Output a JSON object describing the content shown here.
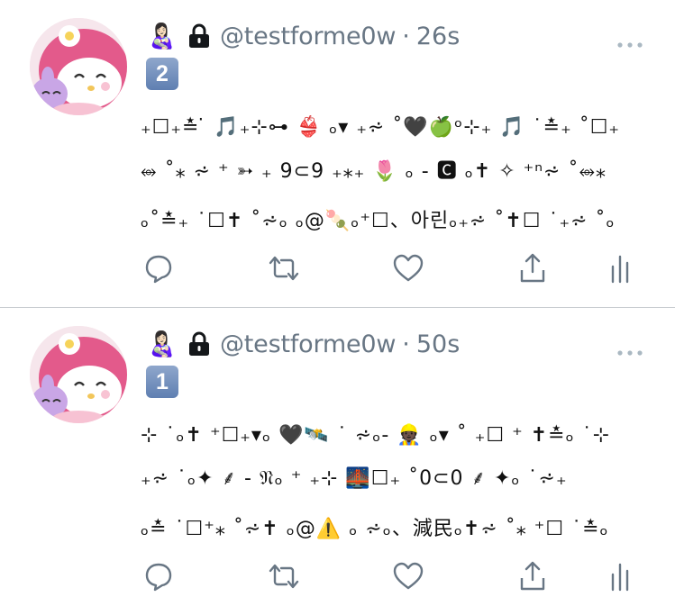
{
  "tweets": [
    {
      "name_emoji": "👩🏻‍🍼",
      "handle": "@testforme0w",
      "separator": "·",
      "time": "26s",
      "number_badge": "2",
      "lines": [
        "₊☐₊≛ ̇ 🎵₊⊹⊶ 👙 ₒ▾ ₊⩫ ˚🖤🍏ᵒ⊹₊ 🎵 ˙≛₊ ˚☐₊",
        "⥈ ˚⁎ ⩫ ⁺ ➳ ₊ 9⊂9 ₊⁎₊ 🌷 ₒ - 🅲 ₒ✝ ✧ ⁺ⁿ⩫ ˚⥈⁎",
        "ₒ˚≛₊ ˙☐✝ ˚⩫ₒ ₒ@🍡ₒ⁺☐、아린ₒ₊⩫ ˚✝☐ ˙₊⩫ ˚ₒ"
      ]
    },
    {
      "name_emoji": "👩🏻‍🍼",
      "handle": "@testforme0w",
      "separator": "·",
      "time": "50s",
      "number_badge": "1",
      "lines": [
        "⊹ ˙ₒ✝ ⁺☐₊▾ₒ 🖤🛰️ ˙ ⩫ₒ- 👷🏿 ₒ▾ ˚ ₊☐ ⁺ ✝≛ₒ ˙⊹",
        "₊⩫ ˙ₒ✦ ⸙ - 𝔑ₒ ⁺ ₊⊹ 🌉☐₊ ˚0⊂0 ⸙ ✦ₒ ˙⩫₊",
        "ₒ≛ ˙☐⁺⁎ ˚⩫✝ ₒ@⚠️ ₒ ⩫ₒ、減民ₒ✝⩫ ˚⁎ ⁺☐ ˙≛ₒ"
      ]
    }
  ],
  "colors": {
    "muted": "#687684",
    "divider": "#c9cdd1",
    "avatar_pink": "#e35a8b"
  },
  "icons": [
    "lock-icon",
    "more-icon",
    "reply-icon",
    "retweet-icon",
    "like-icon",
    "share-icon",
    "analytics-icon"
  ]
}
